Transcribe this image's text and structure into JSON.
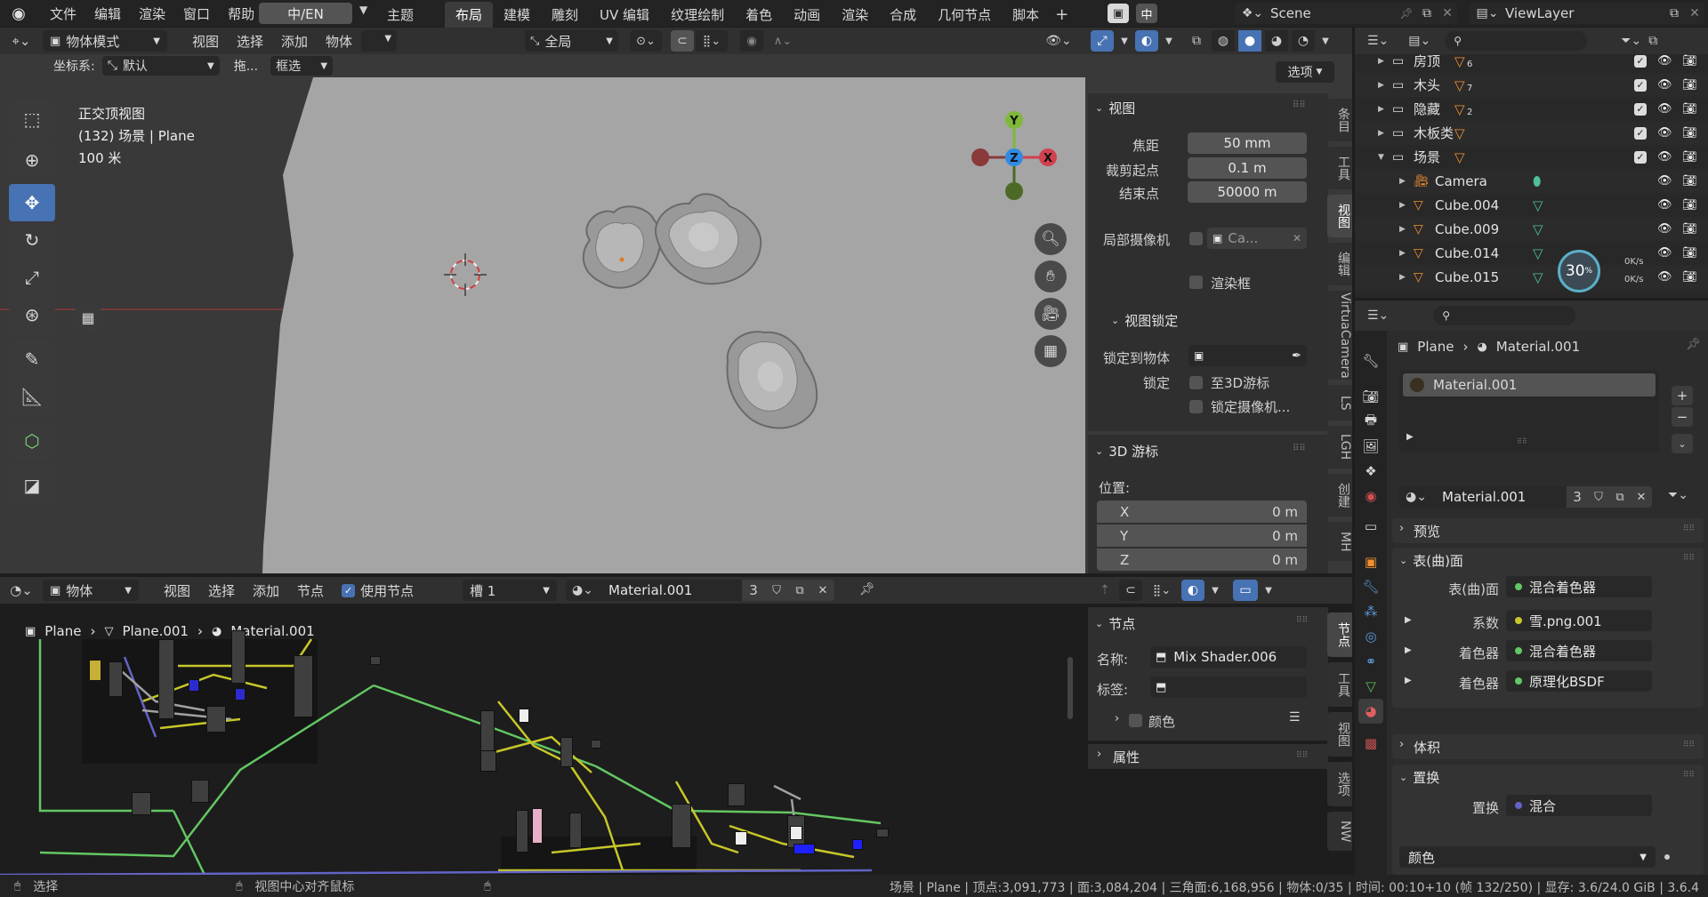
{
  "topbar": {
    "menus": [
      "文件",
      "编辑",
      "渲染",
      "窗口",
      "帮助"
    ],
    "lang": "中/EN",
    "theme": "主题",
    "workspaces": [
      "布局",
      "建模",
      "雕刻",
      "UV 编辑",
      "纹理绘制",
      "着色",
      "动画",
      "渲染",
      "合成",
      "几何节点",
      "脚本"
    ],
    "active_workspace": "布局",
    "scene": "Scene",
    "viewlayer": "ViewLayer"
  },
  "viewport_header": {
    "mode": "物体模式",
    "menus": [
      "视图",
      "选择",
      "添加",
      "物体"
    ],
    "transform": "全局",
    "options": "选项",
    "coord_label": "坐标系:",
    "coord_value": "默认",
    "drag_label": "拖...",
    "select_mode": "框选"
  },
  "viewport": {
    "view_name": "正交顶视图",
    "object_info": "(132) 场景 | Plane",
    "scale": "100 米",
    "background": "#a5a5a5"
  },
  "gizmo": {
    "y": "Y",
    "z": "Z",
    "x": "X"
  },
  "npanel": {
    "view_section": "视图",
    "focal_label": "焦距",
    "focal_value": "50 mm",
    "clip_start_label": "裁剪起点",
    "clip_start_value": "0.1 m",
    "clip_end_label": "结束点",
    "clip_end_value": "50000 m",
    "local_cam_label": "局部摄像机",
    "local_cam_value": "Ca...",
    "render_border": "渲染框",
    "lock_section": "视图锁定",
    "lock_obj_label": "锁定到物体",
    "lock_label": "锁定",
    "lock_cursor": "至3D游标",
    "lock_camera": "锁定摄像机...",
    "cursor_section": "3D 游标",
    "location_label": "位置:",
    "x_label": "X",
    "x_value": "0 m",
    "y_label": "Y",
    "y_value": "0 m",
    "z_label": "Z",
    "z_value": "0 m"
  },
  "npanel_tabs": [
    "条目",
    "工具",
    "视图",
    "编辑",
    "VirtuaCamera",
    "LS",
    "LGH",
    "创建",
    "MH"
  ],
  "outliner": {
    "items": [
      {
        "name": "房顶",
        "badge": "6",
        "indent": 1,
        "type": "collection"
      },
      {
        "name": "木头",
        "badge": "7",
        "indent": 1,
        "type": "collection"
      },
      {
        "name": "隐藏",
        "badge": "2",
        "indent": 1,
        "type": "collection"
      },
      {
        "name": "木板类",
        "badge": "",
        "indent": 1,
        "type": "collection"
      },
      {
        "name": "场景",
        "badge": "",
        "indent": 1,
        "type": "collection"
      },
      {
        "name": "Camera",
        "badge": "",
        "indent": 2,
        "type": "camera"
      },
      {
        "name": "Cube.004",
        "badge": "",
        "indent": 2,
        "type": "mesh"
      },
      {
        "name": "Cube.009",
        "badge": "",
        "indent": 2,
        "type": "mesh"
      },
      {
        "name": "Cube.014",
        "badge": "",
        "indent": 2,
        "type": "mesh"
      },
      {
        "name": "Cube.015",
        "badge": "",
        "indent": 2,
        "type": "mesh"
      }
    ],
    "net_percent": "30",
    "net_up": "0K/s",
    "net_down": "0K/s"
  },
  "properties": {
    "breadcrumb_object": "Plane",
    "breadcrumb_material": "Material.001",
    "slot_name": "Material.001",
    "material_name": "Material.001",
    "users": "3",
    "preview": "预览",
    "surface_section": "表(曲)面",
    "surface_label": "表(曲)面",
    "surface_value": "混合着色器",
    "fac_label": "系数",
    "fac_value": "雪.png.001",
    "shader1_label": "着色器",
    "shader1_value": "混合着色器",
    "shader2_label": "着色器",
    "shader2_value": "原理化BSDF",
    "volume_section": "体积",
    "disp_section": "置换",
    "disp_label": "置换",
    "disp_value": "混合",
    "color_dropdown": "颜色"
  },
  "node_editor": {
    "editor_type": "物体",
    "menus": [
      "视图",
      "选择",
      "添加",
      "节点"
    ],
    "use_nodes": "使用节点",
    "slot": "槽 1",
    "material": "Material.001",
    "users": "3",
    "breadcrumb": [
      "Plane",
      "Plane.001",
      "Material.001"
    ]
  },
  "node_panel": {
    "section": "节点",
    "name_label": "名称:",
    "name_value": "Mix Shader.006",
    "label_label": "标签:",
    "color_label": "颜色",
    "props_section": "属性"
  },
  "node_tabs": [
    "节点",
    "工具",
    "视图",
    "选项",
    "NW"
  ],
  "statusbar": {
    "select": "选择",
    "center": "视图中心对齐鼠标",
    "stats": "场景 | Plane | 顶点:3,091,773 | 面:3,084,204 | 三角面:6,168,956 | 物体:0/35 | 时间: 00:10+10 (帧 132/250) | 显存: 3.6/24.0 GiB | 3.6.4"
  }
}
